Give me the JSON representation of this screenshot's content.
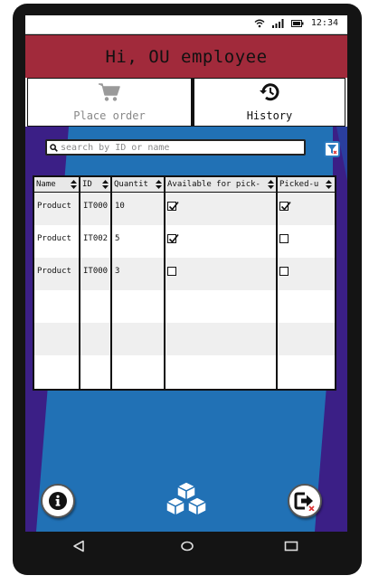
{
  "status_bar": {
    "time": "12:34",
    "icons": [
      "wifi-icon",
      "signal-icon",
      "battery-icon"
    ]
  },
  "header": {
    "greeting": "Hi, OU employee"
  },
  "tabs": [
    {
      "label": "Place order",
      "icon": "cart-icon",
      "active": false
    },
    {
      "label": "History",
      "icon": "history-icon",
      "active": true
    }
  ],
  "search": {
    "placeholder": "search by ID or name"
  },
  "table": {
    "columns": [
      "Name",
      "ID",
      "Quantit",
      "Available for pick-",
      "Picked-u"
    ],
    "rows": [
      {
        "name": "Product",
        "id": "IT000",
        "quantity": "10",
        "available": true,
        "picked": true
      },
      {
        "name": "Product",
        "id": "IT002",
        "quantity": "5",
        "available": true,
        "picked": false
      },
      {
        "name": "Product",
        "id": "IT000",
        "quantity": "3",
        "available": false,
        "picked": false
      }
    ]
  },
  "bottom": {
    "icons": [
      "info-icon",
      "boxes-icon",
      "logout-icon"
    ]
  },
  "colors": {
    "header": "#a12a3b",
    "body": "#2171b5",
    "accent_dark": "#3b1f86"
  }
}
